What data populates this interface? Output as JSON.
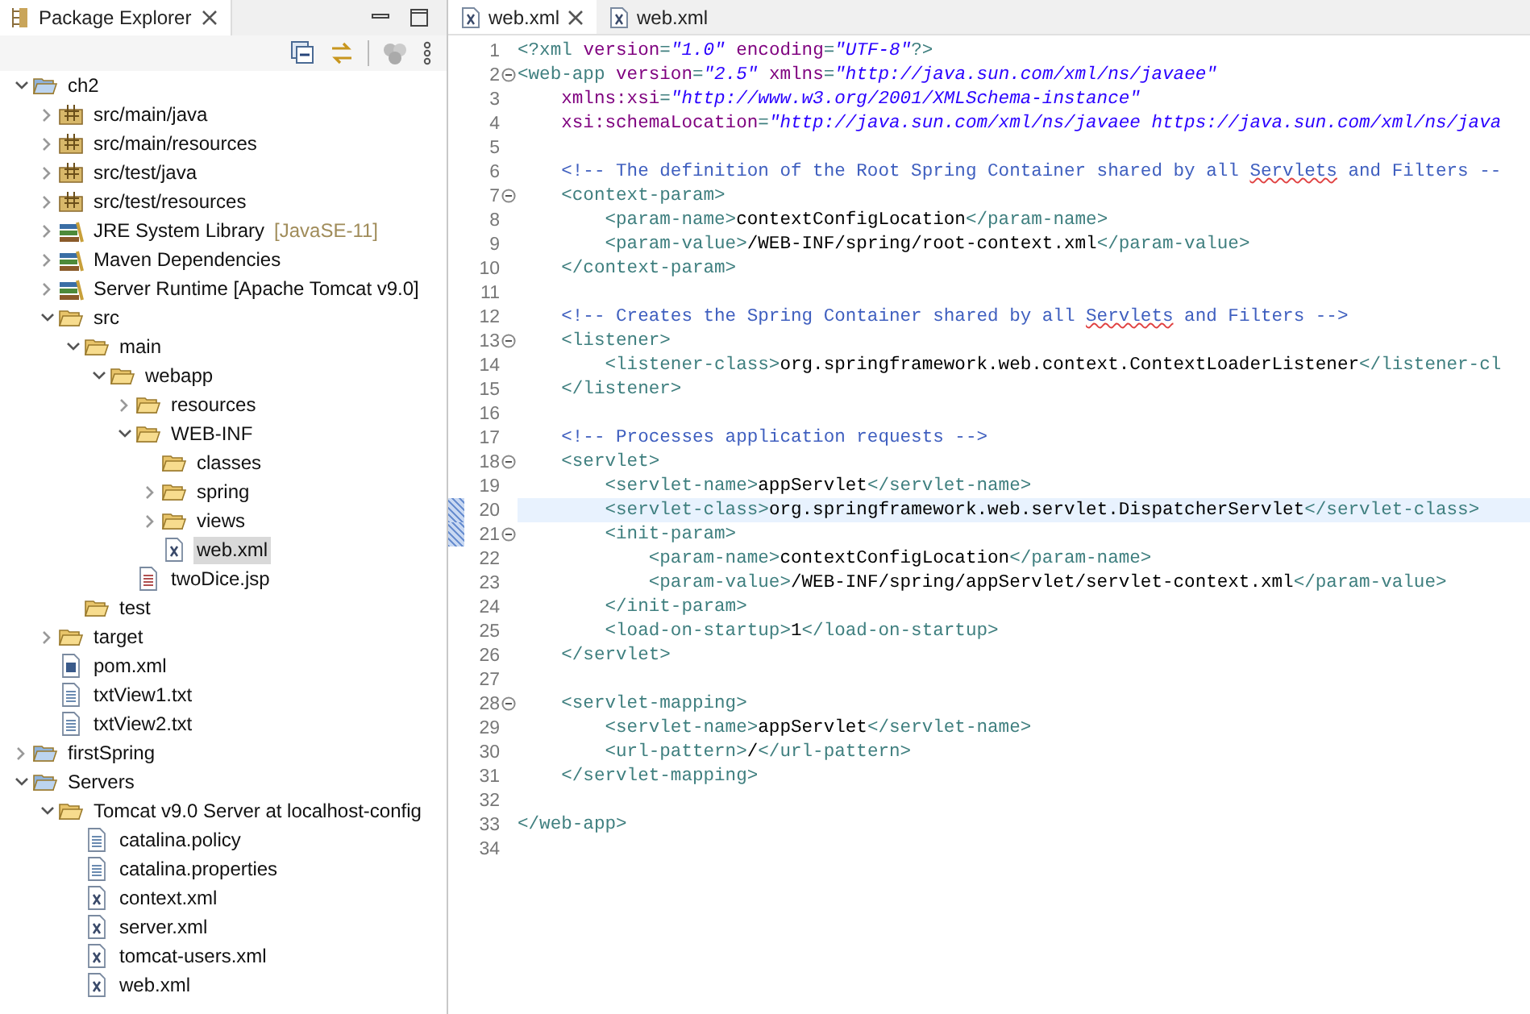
{
  "explorer": {
    "title": "Package Explorer",
    "tree": [
      {
        "label": "ch2",
        "kind": "project",
        "expanded": true,
        "selected": false,
        "children": [
          {
            "label": "src/main/java",
            "kind": "package",
            "expanded": false,
            "selected": false
          },
          {
            "label": "src/main/resources",
            "kind": "package",
            "expanded": false,
            "selected": false
          },
          {
            "label": "src/test/java",
            "kind": "package",
            "expanded": false,
            "selected": false
          },
          {
            "label": "src/test/resources",
            "kind": "package",
            "expanded": false,
            "selected": false
          },
          {
            "label": "JRE System Library",
            "decoration": "[JavaSE-11]",
            "kind": "library",
            "expanded": false,
            "selected": false
          },
          {
            "label": "Maven Dependencies",
            "kind": "library",
            "expanded": false,
            "selected": false
          },
          {
            "label": "Server Runtime [Apache Tomcat v9.0]",
            "kind": "library",
            "expanded": false,
            "selected": false
          },
          {
            "label": "src",
            "kind": "folder",
            "expanded": true,
            "selected": false,
            "children": [
              {
                "label": "main",
                "kind": "folder",
                "expanded": true,
                "selected": false,
                "children": [
                  {
                    "label": "webapp",
                    "kind": "folder",
                    "expanded": true,
                    "selected": false,
                    "children": [
                      {
                        "label": "resources",
                        "kind": "folder",
                        "expanded": false,
                        "selected": false
                      },
                      {
                        "label": "WEB-INF",
                        "kind": "folder",
                        "expanded": true,
                        "selected": false,
                        "children": [
                          {
                            "label": "classes",
                            "kind": "folder",
                            "selected": false
                          },
                          {
                            "label": "spring",
                            "kind": "folder",
                            "expanded": false,
                            "selected": false
                          },
                          {
                            "label": "views",
                            "kind": "folder",
                            "expanded": false,
                            "selected": false
                          },
                          {
                            "label": "web.xml",
                            "kind": "xml",
                            "selected": true
                          }
                        ]
                      },
                      {
                        "label": "twoDice.jsp",
                        "kind": "jsp",
                        "selected": false
                      }
                    ]
                  }
                ]
              },
              {
                "label": "test",
                "kind": "folder",
                "selected": false
              }
            ]
          },
          {
            "label": "target",
            "kind": "folder",
            "expanded": false,
            "selected": false
          },
          {
            "label": "pom.xml",
            "kind": "pom",
            "selected": false
          },
          {
            "label": "txtView1.txt",
            "kind": "text",
            "selected": false
          },
          {
            "label": "txtView2.txt",
            "kind": "text",
            "selected": false
          }
        ]
      },
      {
        "label": "firstSpring",
        "kind": "project",
        "expanded": false,
        "selected": false
      },
      {
        "label": "Servers",
        "kind": "project",
        "expanded": true,
        "selected": false,
        "children": [
          {
            "label": "Tomcat v9.0 Server at localhost-config",
            "kind": "folder",
            "expanded": true,
            "selected": false,
            "children": [
              {
                "label": "catalina.policy",
                "kind": "text",
                "selected": false
              },
              {
                "label": "catalina.properties",
                "kind": "text",
                "selected": false
              },
              {
                "label": "context.xml",
                "kind": "xml",
                "selected": false
              },
              {
                "label": "server.xml",
                "kind": "xml",
                "selected": false
              },
              {
                "label": "tomcat-users.xml",
                "kind": "xml",
                "selected": false
              },
              {
                "label": "web.xml",
                "kind": "xml",
                "selected": false
              }
            ]
          }
        ]
      }
    ]
  },
  "editor": {
    "tabs": [
      {
        "label": "web.xml",
        "selected": true
      },
      {
        "label": "web.xml",
        "selected": false
      }
    ],
    "lines": [
      {
        "n": "1",
        "fold": false,
        "current": false,
        "changed": false,
        "tokens": [
          {
            "kind": "tag",
            "t": "<?xml "
          },
          {
            "kind": "attr",
            "t": "version"
          },
          {
            "kind": "tag",
            "t": "="
          },
          {
            "kind": "value",
            "t": "\"1.0\""
          },
          {
            "kind": "attr",
            "t": " encoding"
          },
          {
            "kind": "tag",
            "t": "="
          },
          {
            "kind": "value",
            "t": "\"UTF-8\""
          },
          {
            "kind": "tag",
            "t": "?>"
          }
        ]
      },
      {
        "n": "2",
        "fold": true,
        "current": false,
        "changed": false,
        "tokens": [
          {
            "kind": "tag",
            "t": "<web-app "
          },
          {
            "kind": "attr",
            "t": "version"
          },
          {
            "kind": "tag",
            "t": "="
          },
          {
            "kind": "value",
            "t": "\"2.5\""
          },
          {
            "kind": "attr",
            "t": " xmlns"
          },
          {
            "kind": "tag",
            "t": "="
          },
          {
            "kind": "value",
            "t": "\"http://java.sun.com/xml/ns/javaee\""
          }
        ]
      },
      {
        "n": "3",
        "fold": false,
        "current": false,
        "changed": false,
        "tokens": [
          {
            "kind": "attr",
            "t": "    xmlns:xsi"
          },
          {
            "kind": "tag",
            "t": "="
          },
          {
            "kind": "value",
            "t": "\"http://www.w3.org/2001/XMLSchema-instance\""
          }
        ]
      },
      {
        "n": "4",
        "fold": false,
        "current": false,
        "changed": false,
        "tokens": [
          {
            "kind": "attr",
            "t": "    xsi:schemaLocation"
          },
          {
            "kind": "tag",
            "t": "="
          },
          {
            "kind": "value",
            "t": "\"http://java.sun.com/xml/ns/javaee https://java.sun.com/xml/ns/java"
          }
        ]
      },
      {
        "n": "5",
        "fold": false,
        "current": false,
        "changed": false
      },
      {
        "n": "6",
        "fold": false,
        "current": false,
        "changed": false,
        "tokens": [
          {
            "kind": "comment",
            "t": "    <!-- The definition of the Root Spring Container shared by all "
          },
          {
            "kind": "typo",
            "t": "Servlets"
          },
          {
            "kind": "comment",
            "t": " and Filters --"
          }
        ]
      },
      {
        "n": "7",
        "fold": true,
        "current": false,
        "changed": false,
        "tokens": [
          {
            "kind": "tag",
            "t": "    <context-param>"
          }
        ]
      },
      {
        "n": "8",
        "fold": false,
        "current": false,
        "changed": false,
        "tokens": [
          {
            "kind": "tag",
            "t": "        <param-name>"
          },
          {
            "kind": "text",
            "t": "contextConfigLocation"
          },
          {
            "kind": "tag",
            "t": "</param-name>"
          }
        ]
      },
      {
        "n": "9",
        "fold": false,
        "current": false,
        "changed": false,
        "tokens": [
          {
            "kind": "tag",
            "t": "        <param-value>"
          },
          {
            "kind": "text",
            "t": "/WEB-INF/spring/root-context.xml"
          },
          {
            "kind": "tag",
            "t": "</param-value>"
          }
        ]
      },
      {
        "n": "10",
        "fold": false,
        "current": false,
        "changed": false,
        "tokens": [
          {
            "kind": "tag",
            "t": "    </context-param>"
          }
        ]
      },
      {
        "n": "11",
        "fold": false,
        "current": false,
        "changed": false
      },
      {
        "n": "12",
        "fold": false,
        "current": false,
        "changed": false,
        "tokens": [
          {
            "kind": "comment",
            "t": "    <!-- Creates the Spring Container shared by all "
          },
          {
            "kind": "typo",
            "t": "Servlets"
          },
          {
            "kind": "comment",
            "t": " and Filters -->"
          }
        ]
      },
      {
        "n": "13",
        "fold": true,
        "current": false,
        "changed": false,
        "tokens": [
          {
            "kind": "tag",
            "t": "    <listener>"
          }
        ]
      },
      {
        "n": "14",
        "fold": false,
        "current": false,
        "changed": false,
        "tokens": [
          {
            "kind": "tag",
            "t": "        <listener-class>"
          },
          {
            "kind": "text",
            "t": "org.springframework.web.context.ContextLoaderListener"
          },
          {
            "kind": "tag",
            "t": "</listener-cl"
          }
        ]
      },
      {
        "n": "15",
        "fold": false,
        "current": false,
        "changed": false,
        "tokens": [
          {
            "kind": "tag",
            "t": "    </listener>"
          }
        ]
      },
      {
        "n": "16",
        "fold": false,
        "current": false,
        "changed": false
      },
      {
        "n": "17",
        "fold": false,
        "current": false,
        "changed": false,
        "tokens": [
          {
            "kind": "comment",
            "t": "    <!-- Processes application requests -->"
          }
        ]
      },
      {
        "n": "18",
        "fold": true,
        "current": false,
        "changed": false,
        "tokens": [
          {
            "kind": "tag",
            "t": "    <servlet>"
          }
        ]
      },
      {
        "n": "19",
        "fold": false,
        "current": false,
        "changed": false,
        "tokens": [
          {
            "kind": "tag",
            "t": "        <servlet-name>"
          },
          {
            "kind": "text",
            "t": "appServlet"
          },
          {
            "kind": "tag",
            "t": "</servlet-name>"
          }
        ]
      },
      {
        "n": "20",
        "fold": false,
        "current": true,
        "changed": true,
        "tokens": [
          {
            "kind": "tag",
            "t": "        <servlet-class>"
          },
          {
            "kind": "text",
            "t": "org.springframework.web.servlet.DispatcherServlet"
          },
          {
            "kind": "tag",
            "t": "</servlet-class>"
          }
        ]
      },
      {
        "n": "21",
        "fold": true,
        "current": false,
        "changed": true,
        "tokens": [
          {
            "kind": "tag",
            "t": "        <init-param>"
          }
        ]
      },
      {
        "n": "22",
        "fold": false,
        "current": false,
        "changed": false,
        "tokens": [
          {
            "kind": "tag",
            "t": "            <param-name>"
          },
          {
            "kind": "text",
            "t": "contextConfigLocation"
          },
          {
            "kind": "tag",
            "t": "</param-name>"
          }
        ]
      },
      {
        "n": "23",
        "fold": false,
        "current": false,
        "changed": false,
        "tokens": [
          {
            "kind": "tag",
            "t": "            <param-value>"
          },
          {
            "kind": "text",
            "t": "/WEB-INF/spring/appServlet/servlet-context.xml"
          },
          {
            "kind": "tag",
            "t": "</param-value>"
          }
        ]
      },
      {
        "n": "24",
        "fold": false,
        "current": false,
        "changed": false,
        "tokens": [
          {
            "kind": "tag",
            "t": "        </init-param>"
          }
        ]
      },
      {
        "n": "25",
        "fold": false,
        "current": false,
        "changed": false,
        "tokens": [
          {
            "kind": "tag",
            "t": "        <load-on-startup>"
          },
          {
            "kind": "text",
            "t": "1"
          },
          {
            "kind": "tag",
            "t": "</load-on-startup>"
          }
        ]
      },
      {
        "n": "26",
        "fold": false,
        "current": false,
        "changed": false,
        "tokens": [
          {
            "kind": "tag",
            "t": "    </servlet>"
          }
        ]
      },
      {
        "n": "27",
        "fold": false,
        "current": false,
        "changed": false
      },
      {
        "n": "28",
        "fold": true,
        "current": false,
        "changed": false,
        "tokens": [
          {
            "kind": "tag",
            "t": "    <servlet-mapping>"
          }
        ]
      },
      {
        "n": "29",
        "fold": false,
        "current": false,
        "changed": false,
        "tokens": [
          {
            "kind": "tag",
            "t": "        <servlet-name>"
          },
          {
            "kind": "text",
            "t": "appServlet"
          },
          {
            "kind": "tag",
            "t": "</servlet-name>"
          }
        ]
      },
      {
        "n": "30",
        "fold": false,
        "current": false,
        "changed": false,
        "tokens": [
          {
            "kind": "tag",
            "t": "        <url-pattern>"
          },
          {
            "kind": "text",
            "t": "/"
          },
          {
            "kind": "tag",
            "t": "</url-pattern>"
          }
        ]
      },
      {
        "n": "31",
        "fold": false,
        "current": false,
        "changed": false,
        "tokens": [
          {
            "kind": "tag",
            "t": "    </servlet-mapping>"
          }
        ]
      },
      {
        "n": "32",
        "fold": false,
        "current": false,
        "changed": false
      },
      {
        "n": "33",
        "fold": false,
        "current": false,
        "changed": false,
        "tokens": [
          {
            "kind": "tag",
            "t": "</web-app>"
          }
        ]
      },
      {
        "n": "34",
        "fold": false,
        "current": false,
        "changed": false
      }
    ]
  }
}
